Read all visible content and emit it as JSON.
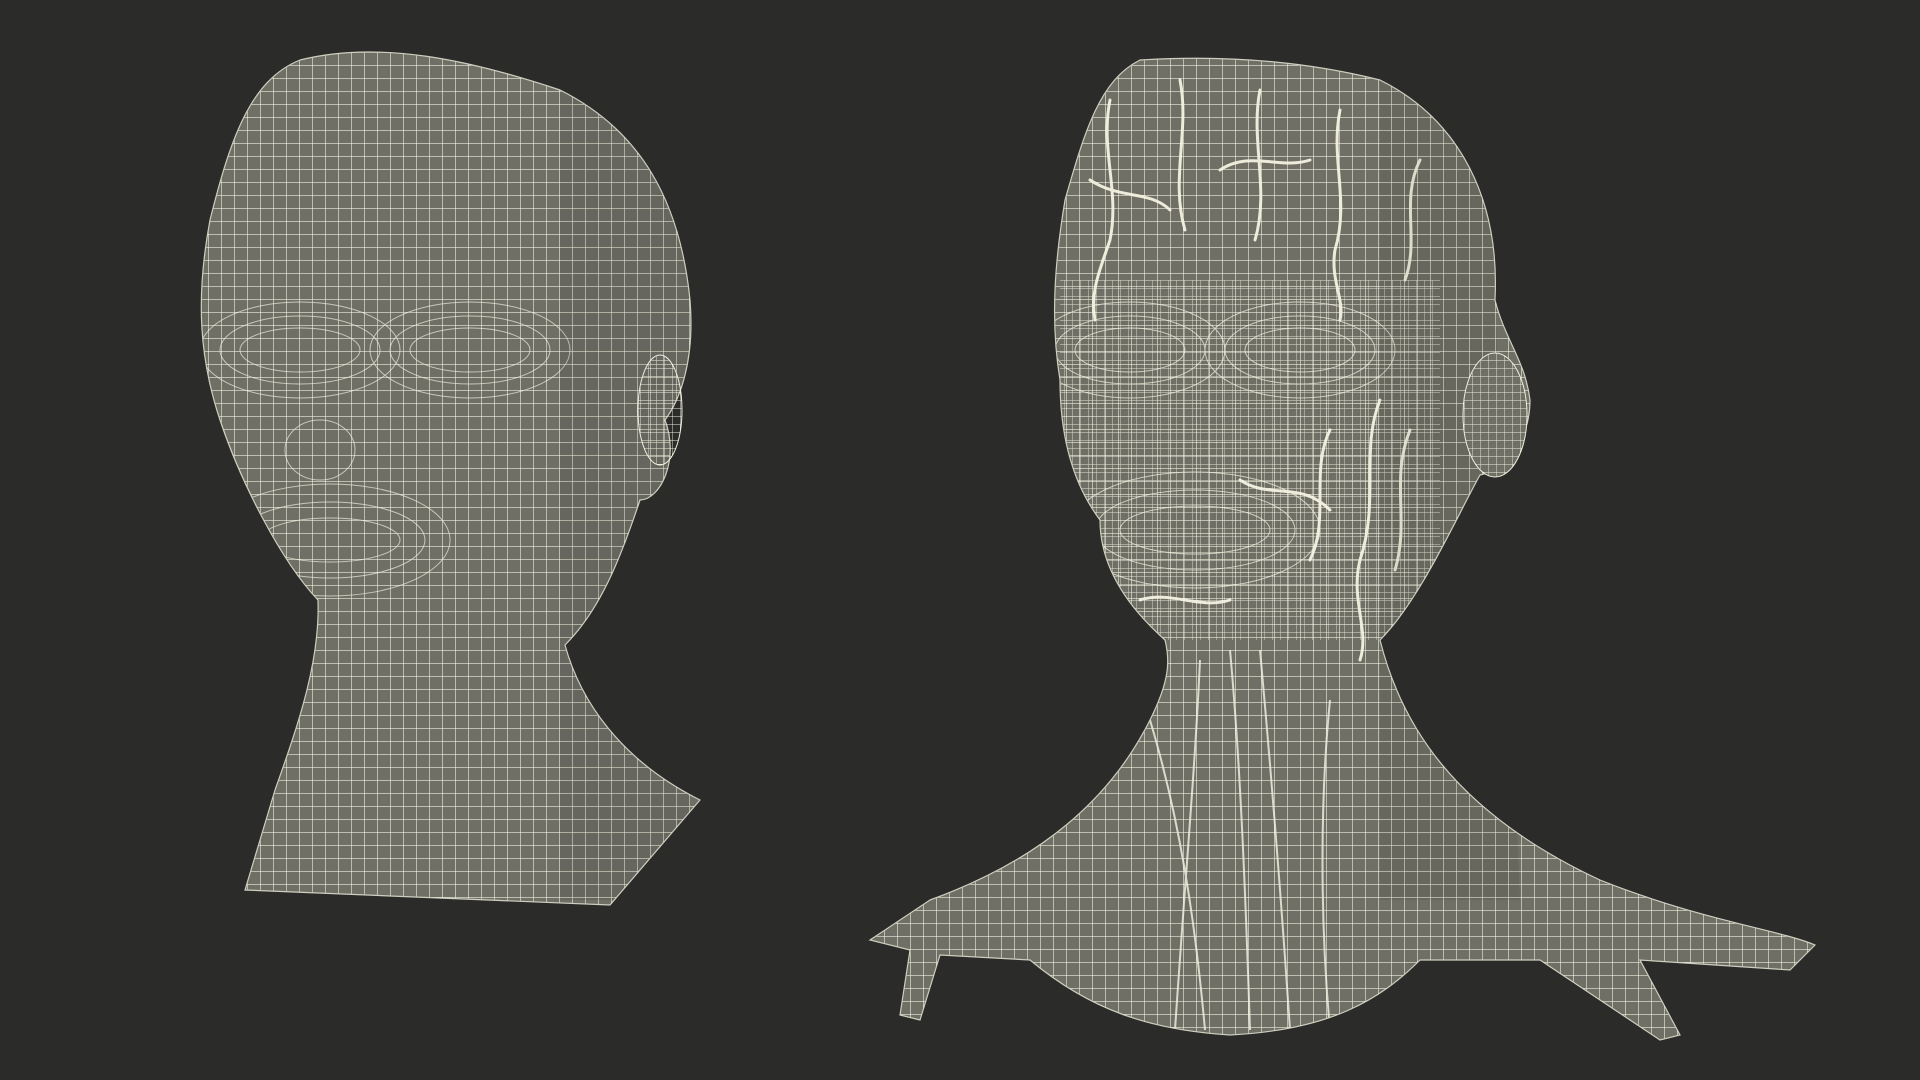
{
  "scene": {
    "background_color": "#2b2b2a",
    "mesh_fill_color": "#6f6f66",
    "mesh_fill_shadow": "#5f5f57",
    "wire_color": "#eeeedd",
    "vessel_color": "#f4f2e0",
    "models": [
      {
        "name": "head-wireframe-model"
      },
      {
        "name": "anatomy-head-neck-wireframe-model"
      }
    ]
  }
}
